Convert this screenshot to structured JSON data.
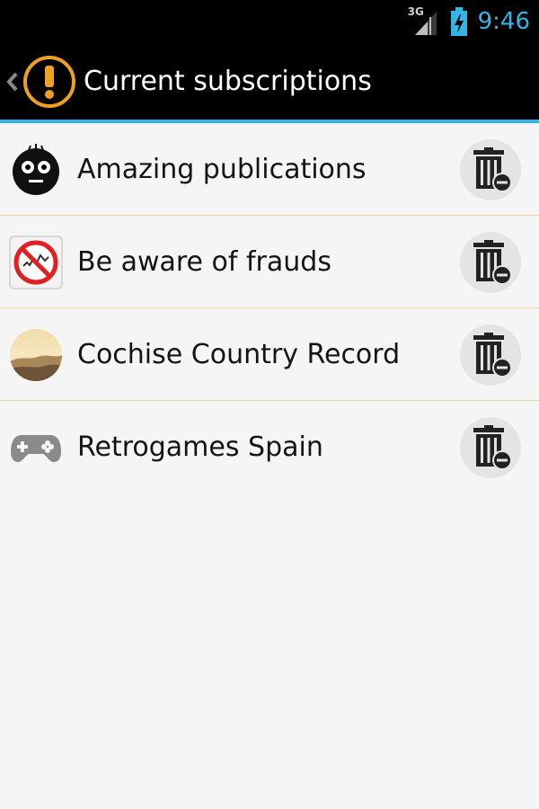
{
  "status_bar": {
    "network_type": "3G",
    "time": "9:46",
    "icons": [
      "signal-icon",
      "battery-charging-icon"
    ]
  },
  "action_bar": {
    "title": "Current subscriptions",
    "icons": [
      "back-chevron-icon",
      "app-logo-icon"
    ]
  },
  "subscriptions": [
    {
      "name": "Amazing publications",
      "icon": "black-face-icon"
    },
    {
      "name": "Be aware of frauds",
      "icon": "no-fraud-icon"
    },
    {
      "name": "Cochise Country Record",
      "icon": "landscape-thumbnail"
    },
    {
      "name": "Retrogames Spain",
      "icon": "gamepad-icon"
    }
  ],
  "actions": {
    "delete_icon": "trash-remove-icon"
  },
  "colors": {
    "accent": "#33b5e5",
    "logo_orange": "#f0a020",
    "divider": "#f5d2a6",
    "background": "#f5f5f5"
  }
}
